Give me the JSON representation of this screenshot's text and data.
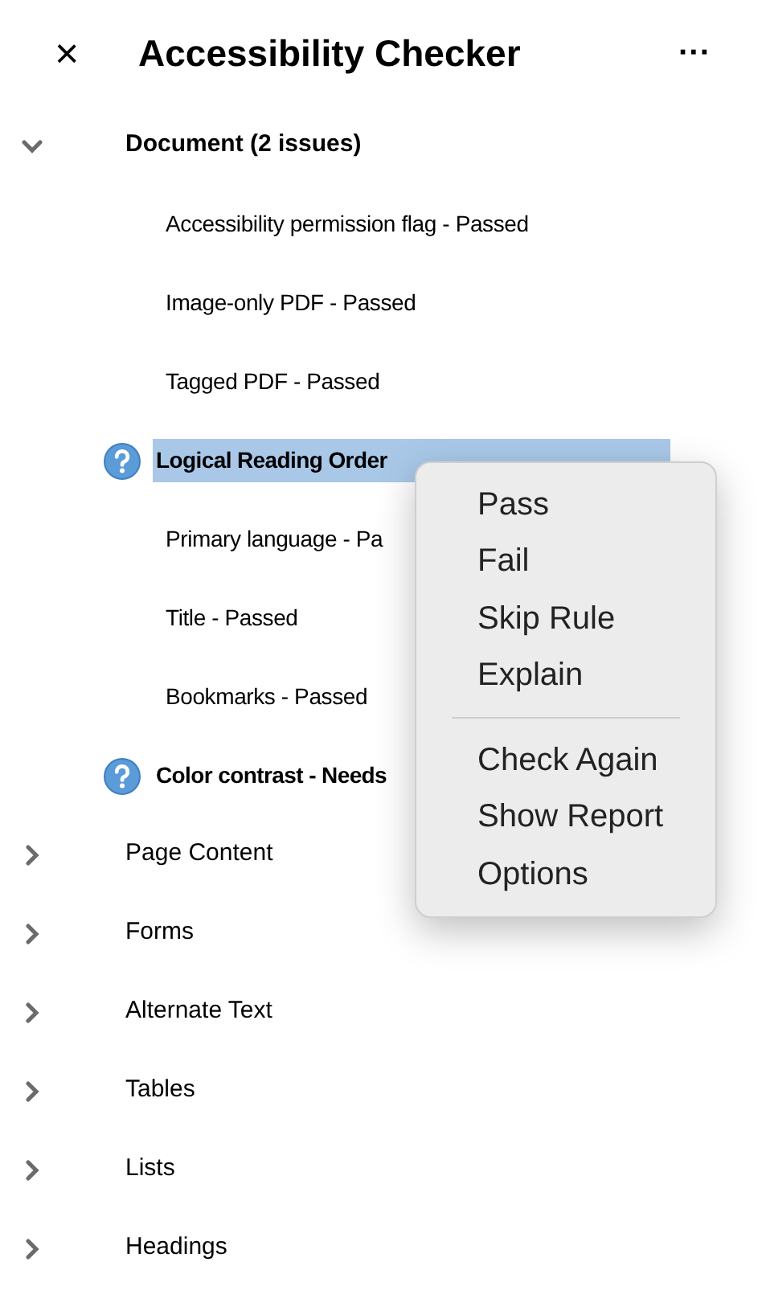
{
  "header": {
    "close": "×",
    "title": "Accessibility Checker",
    "more": "···"
  },
  "sections": [
    {
      "label": "Document (2 issues)",
      "expanded": true,
      "children": [
        {
          "kind": "rule",
          "label": "Accessibility permission flag - Passed",
          "selected": false
        },
        {
          "kind": "rule",
          "label": "Image-only PDF - Passed",
          "selected": false
        },
        {
          "kind": "rule",
          "label": "Tagged PDF - Passed",
          "selected": false
        },
        {
          "kind": "issue",
          "label": "Logical Reading Order",
          "selected": true
        },
        {
          "kind": "rule",
          "label": "Primary language - Pa",
          "selected": false
        },
        {
          "kind": "rule",
          "label": "Title - Passed",
          "selected": false
        },
        {
          "kind": "rule",
          "label": "Bookmarks - Passed",
          "selected": false
        },
        {
          "kind": "issue",
          "label": "Color contrast - Needs",
          "selected": false
        }
      ]
    },
    {
      "label": "Page Content",
      "expanded": false
    },
    {
      "label": "Forms",
      "expanded": false
    },
    {
      "label": "Alternate Text",
      "expanded": false
    },
    {
      "label": "Tables",
      "expanded": false
    },
    {
      "label": "Lists",
      "expanded": false
    },
    {
      "label": "Headings",
      "expanded": false
    }
  ],
  "context_menu": {
    "groups": [
      [
        "Pass",
        "Fail",
        "Skip Rule",
        "Explain"
      ],
      [
        "Check Again",
        "Show Report",
        "Options"
      ]
    ]
  }
}
